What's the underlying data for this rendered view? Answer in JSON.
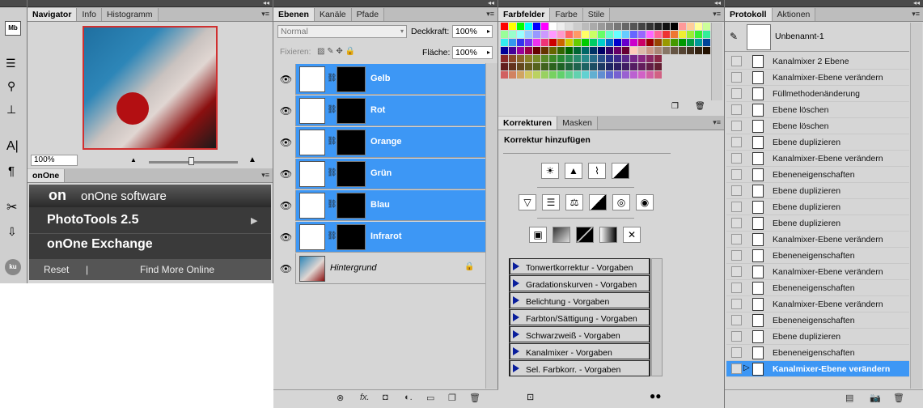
{
  "navigator": {
    "tabs": [
      "Navigator",
      "Info",
      "Histogramm"
    ],
    "zoom": "100%"
  },
  "left_tools": [
    "mb-icon",
    "sliders-icon",
    "brush-settings-icon",
    "stamp-icon",
    "character-icon",
    "paragraph-icon",
    "tools-icon",
    "arrow-tray-icon",
    "ku-icon"
  ],
  "onone": {
    "tab": "onOne",
    "logo": "onOne software",
    "items": [
      "PhotoTools 2.5",
      "onOne Exchange"
    ],
    "reset": "Reset",
    "sep": "|",
    "find_more": "Find More Online"
  },
  "layers_panel": {
    "tabs": [
      "Ebenen",
      "Kanäle",
      "Pfade"
    ],
    "blend_mode": "Normal",
    "opacity_label": "Deckkraft:",
    "opacity_value": "100%",
    "fix_label": "Fixieren:",
    "fill_label": "Fläche:",
    "fill_value": "100%",
    "layers": [
      {
        "name": "Gelb"
      },
      {
        "name": "Rot"
      },
      {
        "name": "Orange"
      },
      {
        "name": "Grün"
      },
      {
        "name": "Blau"
      },
      {
        "name": "Infrarot"
      }
    ],
    "background": "Hintergrund"
  },
  "swatches": {
    "tabs": [
      "Farbfelder",
      "Farbe",
      "Stile"
    ]
  },
  "corrections": {
    "tabs": [
      "Korrekturen",
      "Masken"
    ],
    "heading": "Korrektur hinzufügen",
    "presets": [
      "Tonwertkorrektur - Vorgaben",
      "Gradationskurven - Vorgaben",
      "Belichtung - Vorgaben",
      "Farbton/Sättigung - Vorgaben",
      "Schwarzweiß - Vorgaben",
      "Kanalmixer - Vorgaben",
      "Sel. Farbkorr. - Vorgaben"
    ]
  },
  "history": {
    "tabs": [
      "Protokoll",
      "Aktionen"
    ],
    "snapshot": "Unbenannt-1",
    "items": [
      "Kanalmixer 2 Ebene",
      "Kanalmixer-Ebene verändern",
      "Füllmethodenänderung",
      "Ebene löschen",
      "Ebene löschen",
      "Ebene duplizieren",
      "Kanalmixer-Ebene verändern",
      "Ebeneneigenschaften",
      "Ebene duplizieren",
      "Ebene duplizieren",
      "Ebene duplizieren",
      "Kanalmixer-Ebene verändern",
      "Ebeneneigenschaften",
      "Kanalmixer-Ebene verändern",
      "Ebeneneigenschaften",
      "Kanalmixer-Ebene verändern",
      "Ebeneneigenschaften",
      "Ebene duplizieren",
      "Ebeneneigenschaften",
      "Kanalmixer-Ebene verändern"
    ]
  },
  "colors": {
    "selection": "#3d97f5",
    "panel": "#d6d6d6"
  }
}
